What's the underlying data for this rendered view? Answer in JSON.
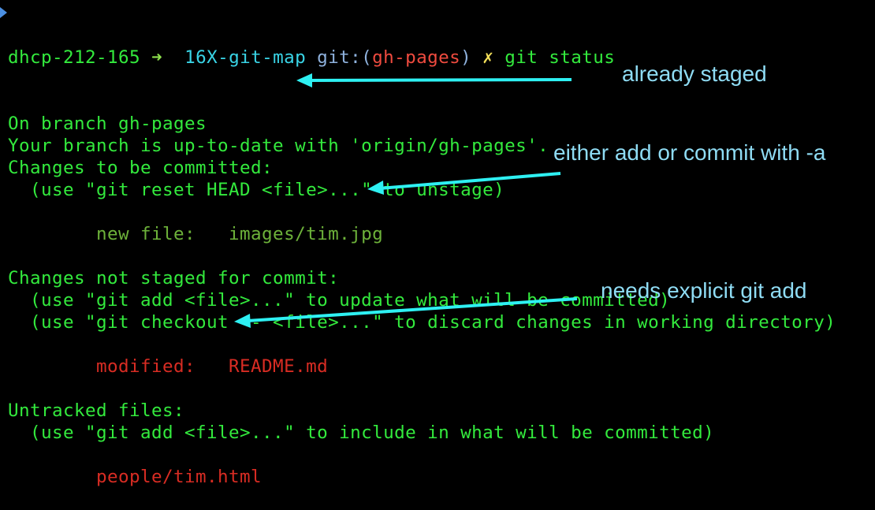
{
  "terminal": {
    "prompt": {
      "host": "dhcp-212-165",
      "arrow_glyph": "➜",
      "directory": "16X-git-map",
      "git_label": "git:(",
      "branch": "gh-pages",
      "git_close": ")",
      "dirty_glyph": "✗",
      "command": "git status"
    },
    "lines": [
      {
        "text": "On branch gh-pages",
        "kind": "info"
      },
      {
        "text": "Your branch is up-to-date with 'origin/gh-pages'.",
        "kind": "info"
      },
      {
        "text": "Changes to be committed:",
        "kind": "header"
      },
      {
        "text": "  (use \"git reset HEAD <file>...\" to unstage)",
        "kind": "hint"
      },
      {
        "text": "",
        "kind": "blank"
      },
      {
        "text": "        new file:   images/tim.jpg",
        "kind": "staged"
      },
      {
        "text": "",
        "kind": "blank"
      },
      {
        "text": "Changes not staged for commit:",
        "kind": "header"
      },
      {
        "text": "  (use \"git add <file>...\" to update what will be committed)",
        "kind": "hint"
      },
      {
        "text": "  (use \"git checkout -- <file>...\" to discard changes in working directory)",
        "kind": "hint"
      },
      {
        "text": "",
        "kind": "blank"
      },
      {
        "text": "        modified:   README.md",
        "kind": "unstaged"
      },
      {
        "text": "",
        "kind": "blank"
      },
      {
        "text": "Untracked files:",
        "kind": "header"
      },
      {
        "text": "  (use \"git add <file>...\" to include in what will be committed)",
        "kind": "hint"
      },
      {
        "text": "",
        "kind": "blank"
      },
      {
        "text": "        people/tim.html",
        "kind": "unstaged"
      }
    ]
  },
  "annotations": [
    {
      "label": "already staged",
      "points_to": "Changes to be committed:"
    },
    {
      "label": "either add or commit with -a",
      "points_to": "Changes not staged for commit:"
    },
    {
      "label": "needs explicit git add",
      "points_to": "Untracked files:"
    }
  ],
  "colors": {
    "background": "#000000",
    "output_green": "#33ea3d",
    "staged_green": "#6db23a",
    "unstaged_red": "#d82c23",
    "annotation_text": "#8fdcf4",
    "annotation_arrow": "#2ef0f2"
  }
}
